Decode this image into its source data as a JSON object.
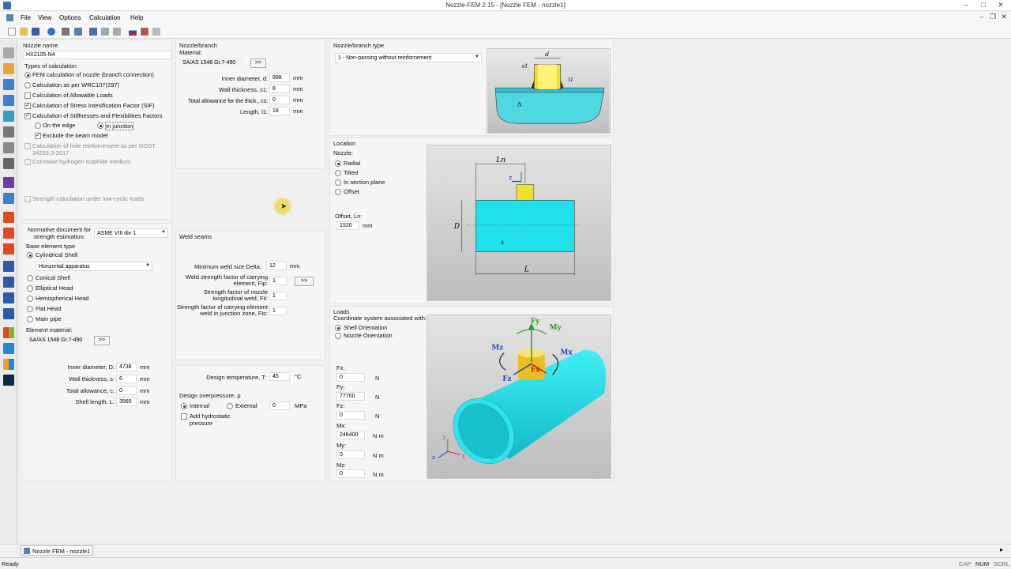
{
  "window": {
    "title": "Nozzle-FEM 2.15 - [Nozzle FEM - nozzle1]"
  },
  "menu": {
    "file": "File",
    "view": "View",
    "options": "Options",
    "calculation": "Calculation",
    "help": "Help"
  },
  "left": {
    "nozzle_name_label": "Nozzle name:",
    "nozzle_name": "HX2105-N4",
    "types_label": "Types of calculation",
    "fem_calc": "FEM calculation of nozzle (branch connection)",
    "wrc_calc": "Calculation as per WRC107(297)",
    "allow_loads": "Calculation of Allowable Loads",
    "sif": "Calculation of Stress Intesification Factor (SIF)",
    "stiff": "Calculation of Stiffnesses and Flexibilities Factors",
    "on_edge": "On the edge",
    "in_junction": "In junction",
    "exclude_beam": "Exclude the beam model",
    "gost": "Calculation of hole reinforcement as per GOST 34233.3-2017",
    "corrosive": "Corrosive hydrogen sulphide medium",
    "low_cyclic": "Strength calculation under low-cyclic loads",
    "norm_doc_label": "Normative document for strength estimation:",
    "norm_doc": "ASME VIII div 1",
    "base_type_label": "Base element type",
    "cyl_shell": "Cylindrical Shell",
    "horiz_app": "Horizontal apparatus",
    "conical": "Conical Shell",
    "elliptical": "Elliptical Head",
    "hemispherical": "Hemispherical Head",
    "flat": "Flat Head",
    "main_pipe": "Main pipe",
    "elem_material_label": "Element material:",
    "elem_material": "SA/AS 1548 Gr.7-490",
    "browse": ">>",
    "inner_d_label": "Inner diameter, D:",
    "inner_d": "4738",
    "wall_s_label": "Wall thickness, s:",
    "wall_s": "6",
    "total_c_label": "Total allowance, c:",
    "total_c": "0",
    "shell_len_label": "Shell length, L:",
    "shell_len": "3565",
    "unit_mm": "mm"
  },
  "branch": {
    "section_label": "Nozzle/branch",
    "material_label": "Material:",
    "material": "SA/AS 1548 Gr.7-490",
    "inner_d_label": "Inner diameter, d:",
    "inner_d": "898",
    "wall_label": "Wall thickness, s1:",
    "wall": "8",
    "allow_label": "Total allowance for the thick., cs:",
    "allow": "0",
    "length_label": "Length, l1:",
    "length": "18"
  },
  "weld": {
    "section_label": "Weld seams",
    "min_size_label": "Minimum weld size Delta:",
    "min_size": "12",
    "fip_label": "Weld strength factor of carrying element, Fip:",
    "fip": "1",
    "fil_label": "Strength factor of nozzle longitudinal weld, Fil:",
    "fil": "1",
    "fis_label": "Strength factor of carrying element weld in junction zone, Fis:",
    "fis": "1"
  },
  "design": {
    "temp_label": "Design temperature, T:",
    "temp": "45",
    "temp_unit": "°C",
    "pressure_label": "Design overpressure, p",
    "internal": "Internal",
    "external": "External",
    "pressure": "0",
    "pressure_unit": "MPa",
    "hydro": "Add hydrostatic pressure"
  },
  "type": {
    "section_label": "Nozzle/branch type",
    "value": "1 - Non-passing without reinforcement"
  },
  "location": {
    "section_label": "Location",
    "nozzle_label": "Nozzle:",
    "radial": "Radial",
    "tilted": "Tilted",
    "in_section": "In section plane",
    "offset": "Offset",
    "offset_label": "Offset, Ln:",
    "offset_value": "1520"
  },
  "loads": {
    "section_label": "Loads",
    "coord_label": "Coordinate system associated with:",
    "shell_orient": "Shell Orientation",
    "nozzle_orient": "Nozzle Orientation",
    "fx_label": "Fx:",
    "fx": "0",
    "fy_label": "Fy:",
    "fy": "77700",
    "fz_label": "Fz:",
    "fz": "0",
    "mx_label": "Mx:",
    "mx": "246400",
    "my_label": "My:",
    "my": "0",
    "mz_label": "Mz:",
    "mz": "0",
    "unit_n": "N",
    "unit_nm": "N m"
  },
  "diagram_labels": {
    "d": "d",
    "s1": "s1",
    "l1": "l1",
    "delta": "Δ",
    "ln": "Ln",
    "D": "D",
    "s": "s",
    "L": "L",
    "z": "z",
    "y": "y",
    "x": "x",
    "Fy": "Fy",
    "My": "My",
    "Mz": "Mz",
    "Mx": "Mx",
    "Fz": "Fz",
    "Fx": "Fx"
  },
  "taskbar": {
    "item": "Nozzle FEM - nozzle1"
  },
  "status": {
    "ready": "Ready",
    "cap": "CAP",
    "num": "NUM",
    "scrl": "SCRL"
  }
}
